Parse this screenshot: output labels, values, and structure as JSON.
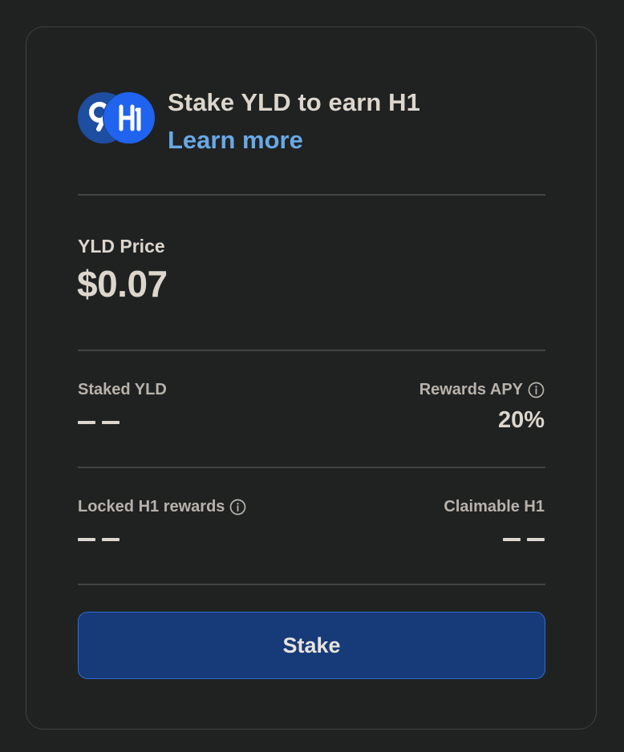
{
  "header": {
    "title": "Stake YLD to earn H1",
    "learn_more": "Learn more",
    "token_logos": [
      "yld-logo-icon",
      "h1-logo-icon"
    ]
  },
  "price": {
    "label": "YLD Price",
    "value": "$0.07"
  },
  "stats": {
    "staked_yld": {
      "label": "Staked YLD",
      "value": "– –"
    },
    "rewards_apy": {
      "label": "Rewards APY",
      "value": "20%",
      "icon": "info-icon"
    },
    "locked_h1_rewards": {
      "label": "Locked H1 rewards",
      "value": "– –",
      "icon": "info-icon"
    },
    "claimable_h1": {
      "label": "Claimable H1",
      "value": "– –"
    }
  },
  "actions": {
    "stake_label": "Stake"
  },
  "colors": {
    "background": "#202222",
    "text": "#ddd6cd",
    "muted_text": "#b8b2aa",
    "link": "#6aa8e6",
    "button_bg": "#173a78",
    "button_border": "#2f6bd6",
    "h1_logo": "#1f63ee",
    "yld_logo": "#1e4ea0"
  }
}
